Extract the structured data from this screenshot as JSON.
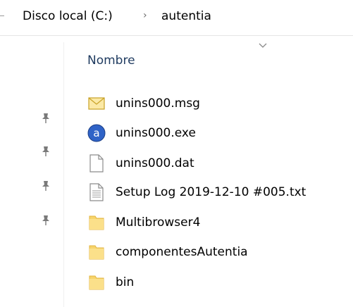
{
  "breadcrumb": {
    "items": [
      "Disco local (C:)",
      "autentia"
    ],
    "separator": "›"
  },
  "column_header": {
    "name_label": "Nombre"
  },
  "files": [
    {
      "name": "unins000.msg",
      "icon": "mail-file-icon"
    },
    {
      "name": "unins000.exe",
      "icon": "app-exe-icon"
    },
    {
      "name": "unins000.dat",
      "icon": "blank-file-icon"
    },
    {
      "name": "Setup Log 2019-12-10 #005.txt",
      "icon": "text-file-icon"
    },
    {
      "name": "Multibrowser4",
      "icon": "folder-icon"
    },
    {
      "name": "componentesAutentia",
      "icon": "folder-icon"
    },
    {
      "name": "bin",
      "icon": "folder-icon"
    }
  ],
  "colors": {
    "folder": "#f7d46b",
    "header_text": "#1e3a5f",
    "app_icon": "#2f63c7",
    "pin": "#7a7a7a"
  }
}
